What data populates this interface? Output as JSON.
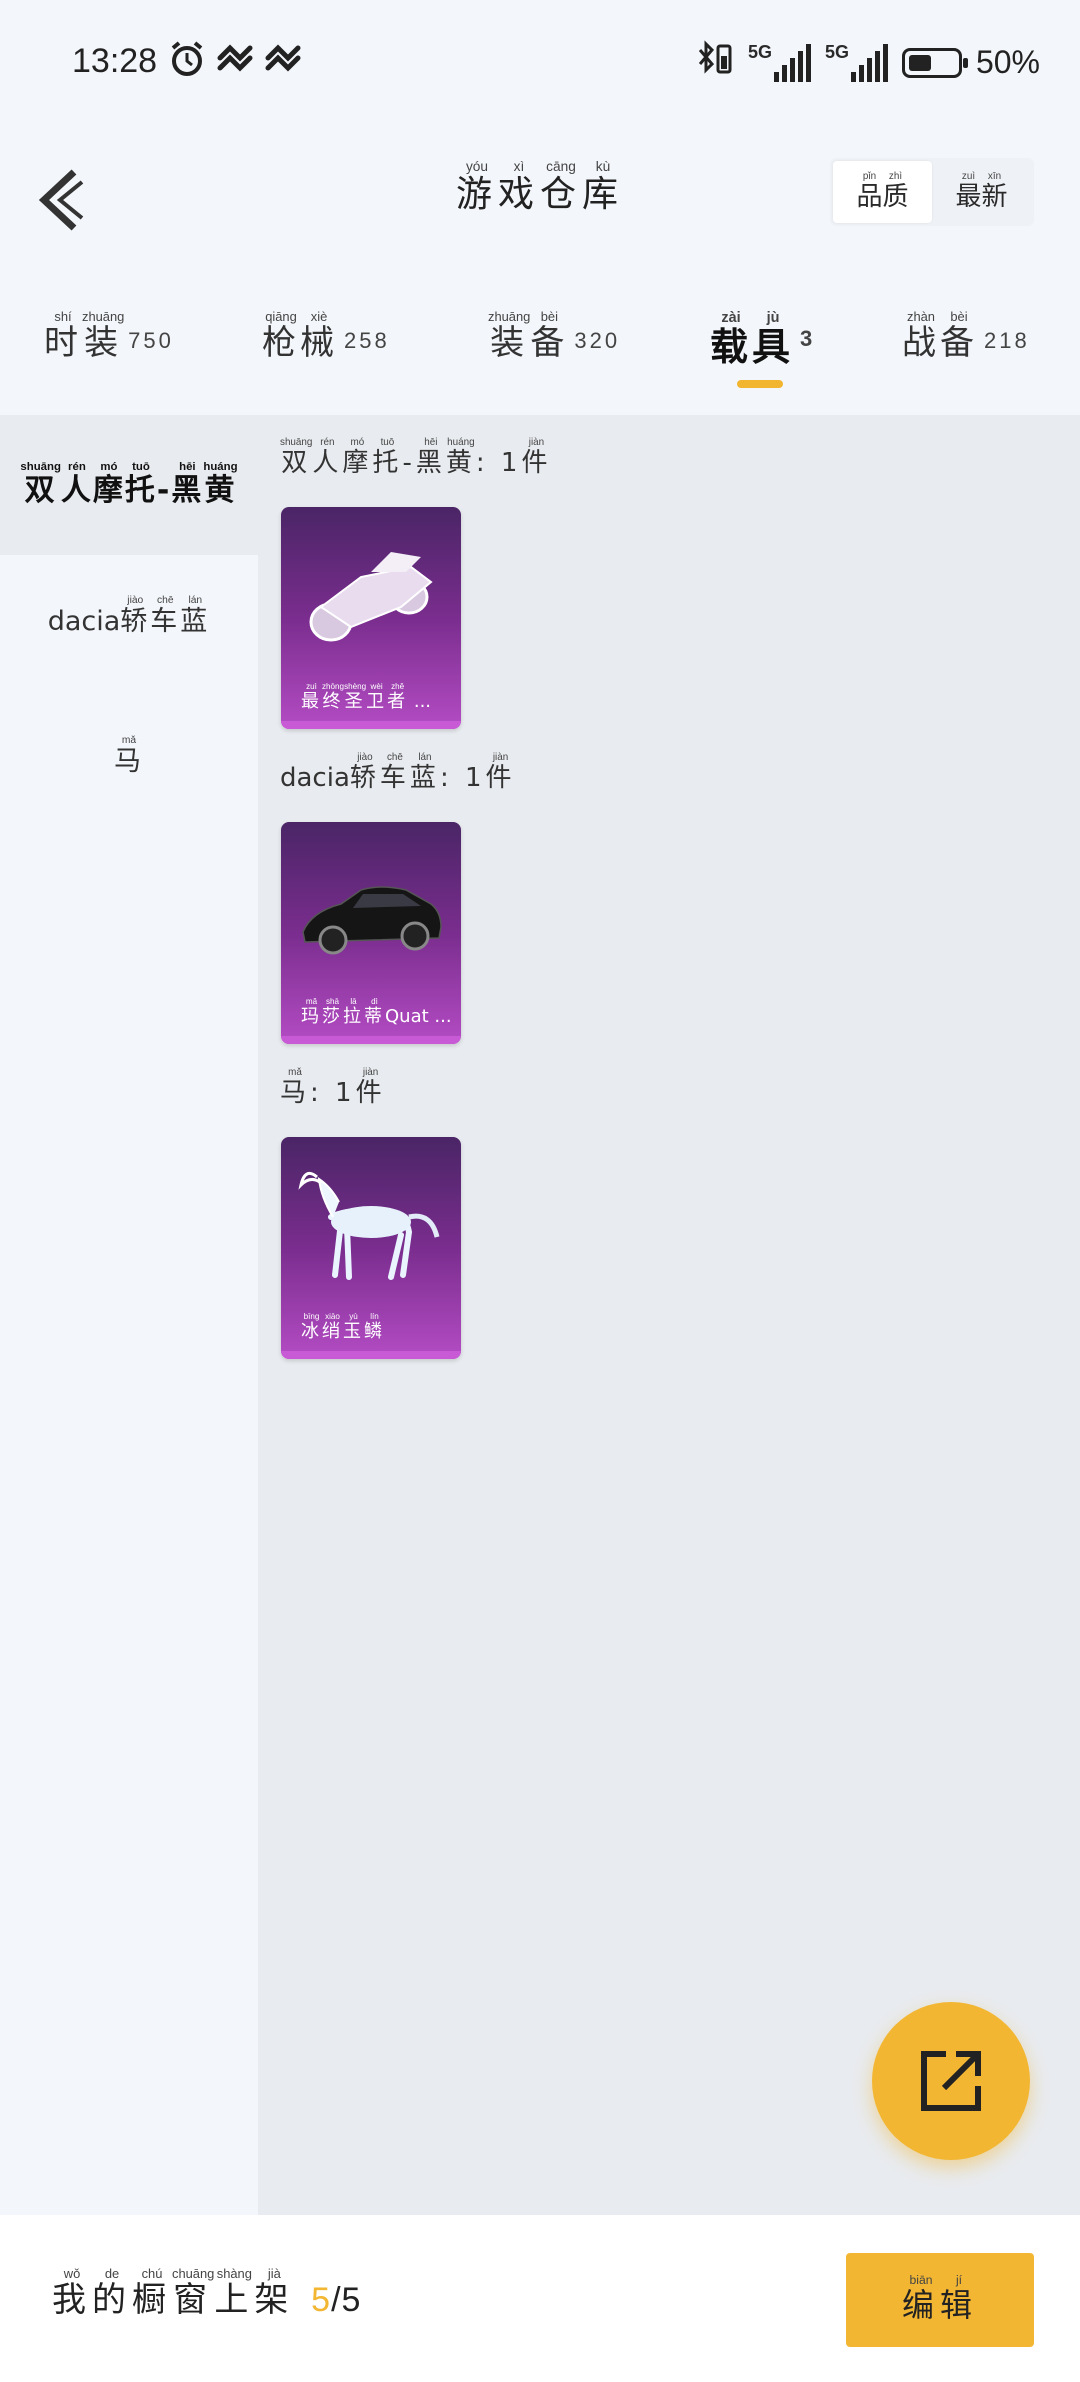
{
  "status_bar": {
    "time": "13:28",
    "network_1": "5G",
    "network_2": "5G",
    "battery_level": 0.5,
    "battery_text": "50%"
  },
  "header": {
    "title": [
      {
        "char": "游",
        "py": "yóu"
      },
      {
        "char": "戏",
        "py": "xì"
      },
      {
        "char": "仓",
        "py": "cāng"
      },
      {
        "char": "库",
        "py": "kù"
      }
    ],
    "sort_options": [
      {
        "chars": [
          {
            "char": "品",
            "py": "pǐn"
          },
          {
            "char": "质",
            "py": "zhì"
          }
        ],
        "active": true
      },
      {
        "chars": [
          {
            "char": "最",
            "py": "zuì"
          },
          {
            "char": "新",
            "py": "xīn"
          }
        ],
        "active": false
      }
    ]
  },
  "tabs": [
    {
      "chars": [
        {
          "char": "时",
          "py": "shí"
        },
        {
          "char": "装",
          "py": "zhuāng"
        }
      ],
      "count": "750"
    },
    {
      "chars": [
        {
          "char": "枪",
          "py": "qiāng"
        },
        {
          "char": "械",
          "py": "xiè"
        }
      ],
      "count": "258"
    },
    {
      "chars": [
        {
          "char": "装",
          "py": "zhuāng"
        },
        {
          "char": "备",
          "py": "bèi"
        }
      ],
      "count": "320"
    },
    {
      "chars": [
        {
          "char": "载",
          "py": "zài"
        },
        {
          "char": "具",
          "py": "jù"
        }
      ],
      "count": "3",
      "active": true
    },
    {
      "chars": [
        {
          "char": "战",
          "py": "zhàn"
        },
        {
          "char": "备",
          "py": "bèi"
        }
      ],
      "count": "218"
    }
  ],
  "sidebar": [
    {
      "prefix": "",
      "chars": [
        {
          "char": "双",
          "py": "shuāng"
        },
        {
          "char": "人",
          "py": "rén"
        },
        {
          "char": "摩",
          "py": "mó"
        },
        {
          "char": "托",
          "py": "tuō"
        },
        {
          "char": "-",
          "py": ""
        },
        {
          "char": "黑",
          "py": "hēi"
        },
        {
          "char": "黄",
          "py": "huáng"
        }
      ],
      "active": true
    },
    {
      "prefix": "dacia",
      "chars": [
        {
          "char": "轿",
          "py": "jiào"
        },
        {
          "char": "车",
          "py": "chē"
        },
        {
          "char": "蓝",
          "py": "lán"
        }
      ],
      "active": false
    },
    {
      "prefix": "",
      "chars": [
        {
          "char": "马",
          "py": "mǎ"
        }
      ],
      "active": false
    }
  ],
  "groups": [
    {
      "title_prefix": "",
      "title_chars": [
        {
          "char": "双",
          "py": "shuāng"
        },
        {
          "char": "人",
          "py": "rén"
        },
        {
          "char": "摩",
          "py": "mó"
        },
        {
          "char": "托",
          "py": "tuō"
        },
        {
          "char": "-",
          "py": ""
        },
        {
          "char": "黑",
          "py": "hēi"
        },
        {
          "char": "黄",
          "py": "huáng"
        }
      ],
      "qty": ": 1",
      "unit": {
        "char": "件",
        "py": "jiàn"
      },
      "card_label": [
        {
          "char": "最",
          "py": "zuì"
        },
        {
          "char": "终",
          "py": "zhōng"
        },
        {
          "char": "圣",
          "py": "shèng"
        },
        {
          "char": "卫",
          "py": "wèi"
        },
        {
          "char": "者",
          "py": "zhě"
        }
      ],
      "card_label_suffix": " ...",
      "card_art": "motorcycle"
    },
    {
      "title_prefix": "dacia",
      "title_chars": [
        {
          "char": "轿",
          "py": "jiào"
        },
        {
          "char": "车",
          "py": "chē"
        },
        {
          "char": "蓝",
          "py": "lán"
        }
      ],
      "qty": ": 1",
      "unit": {
        "char": "件",
        "py": "jiàn"
      },
      "card_label": [
        {
          "char": "玛",
          "py": "mǎ"
        },
        {
          "char": "莎",
          "py": "shā"
        },
        {
          "char": "拉",
          "py": "lā"
        },
        {
          "char": "蒂",
          "py": "dì"
        }
      ],
      "card_label_suffix": "Quat ...",
      "card_art": "sedan"
    },
    {
      "title_prefix": "",
      "title_chars": [
        {
          "char": "马",
          "py": "mǎ"
        }
      ],
      "qty": ": 1",
      "unit": {
        "char": "件",
        "py": "jiàn"
      },
      "card_label": [
        {
          "char": "冰",
          "py": "bīng"
        },
        {
          "char": "绡",
          "py": "xiāo"
        },
        {
          "char": "玉",
          "py": "yù"
        },
        {
          "char": "鳞",
          "py": "lín"
        }
      ],
      "card_label_suffix": "",
      "card_art": "horse"
    }
  ],
  "fab": {
    "icon": "share-external-icon"
  },
  "footer": {
    "shelf_chars": [
      {
        "char": "我",
        "py": "wǒ"
      },
      {
        "char": "的",
        "py": "de"
      },
      {
        "char": "橱",
        "py": "chú"
      },
      {
        "char": "窗",
        "py": "chuāng"
      },
      {
        "char": "上",
        "py": "shàng"
      },
      {
        "char": "架",
        "py": "jià"
      }
    ],
    "shelf_current": "5",
    "shelf_sep": "/",
    "shelf_total": "5",
    "edit_chars": [
      {
        "char": "编",
        "py": "biān"
      },
      {
        "char": "辑",
        "py": "jí"
      }
    ]
  },
  "colors": {
    "accent": "#f2b632",
    "card_purple": "#7a2d8e",
    "sidebar_active": "#e8ebef"
  }
}
